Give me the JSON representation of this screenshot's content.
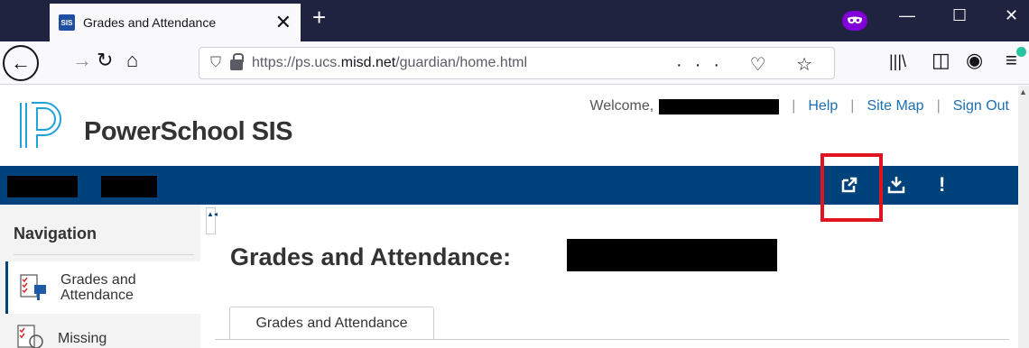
{
  "browser": {
    "tab": {
      "favicon_text": "SIS",
      "title": "Grades and Attendance",
      "close_glyph": "✕"
    },
    "newtab_glyph": "+",
    "window_controls": {
      "minimize": "—",
      "maximize": "☐",
      "close": "✕"
    },
    "toolbar": {
      "back_glyph": "←",
      "forward_glyph": "→",
      "reload_glyph": "↻",
      "home_glyph": "⌂",
      "url_prefix": "https://ps.ucs.",
      "url_domain": "misd.net",
      "url_path": "/guardian/home.html",
      "page_actions": "··· ♡ ☆",
      "library_glyph": "|||\\",
      "sidebar_glyph": "◫",
      "account_glyph": "◉",
      "menu_glyph": "≡"
    }
  },
  "page": {
    "brand": "PowerSchool SIS",
    "header": {
      "welcome": "Welcome,",
      "help": "Help",
      "site_map": "Site Map",
      "sign_out": "Sign Out",
      "separator": "|"
    },
    "bar_icons": {
      "open_external": "⬈",
      "download": "⤓",
      "alert": "!"
    },
    "navigation": {
      "title": "Navigation",
      "items": [
        {
          "label_line1": "Grades and",
          "label_line2": "Attendance"
        },
        {
          "label_line1": "Missing",
          "label_line2": ""
        }
      ]
    },
    "content": {
      "title": "Grades and Attendance:",
      "tab_label": "Grades and Attendance"
    },
    "collapse_glyph": "▲◂"
  },
  "colors": {
    "tab_strip": "#202340",
    "powerschool_blue": "#00427c",
    "link_blue": "#1a6fb5",
    "highlight_red": "#e0141e",
    "private_purple": "#8000d7"
  }
}
